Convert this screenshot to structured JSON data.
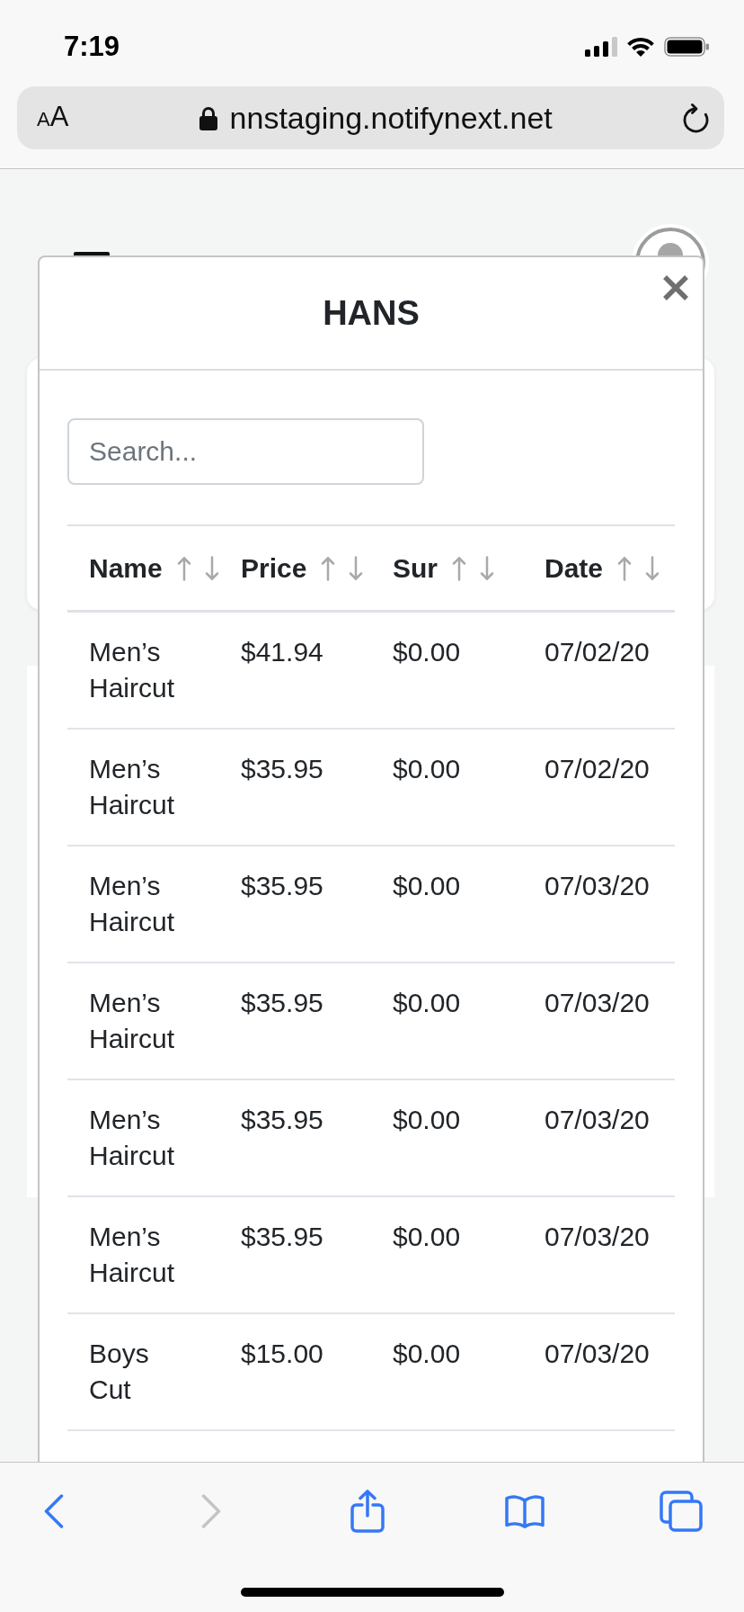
{
  "status_bar": {
    "time": "7:19"
  },
  "browser_bar": {
    "text_size_button": "AA",
    "url": "nnstaging.notifynext.net"
  },
  "modal": {
    "title": "HANS",
    "search": {
      "placeholder": "Search..."
    },
    "table": {
      "columns": [
        {
          "label": "Name"
        },
        {
          "label": "Price"
        },
        {
          "label": "Sur"
        },
        {
          "label": "Date"
        }
      ],
      "rows": [
        {
          "cells": [
            "Men’s Haircut",
            "$41.94",
            "$0.00",
            "07/02/20"
          ]
        },
        {
          "cells": [
            "Men’s Haircut",
            "$35.95",
            "$0.00",
            "07/02/20"
          ]
        },
        {
          "cells": [
            "Men’s Haircut",
            "$35.95",
            "$0.00",
            "07/03/20"
          ]
        },
        {
          "cells": [
            "Men’s Haircut",
            "$35.95",
            "$0.00",
            "07/03/20"
          ]
        },
        {
          "cells": [
            "Men’s Haircut",
            "$35.95",
            "$0.00",
            "07/03/20"
          ]
        },
        {
          "cells": [
            "Men’s Haircut",
            "$35.95",
            "$0.00",
            "07/03/20"
          ]
        },
        {
          "cells": [
            "Boys Cut",
            "$15.00",
            "$0.00",
            "07/03/20"
          ]
        }
      ]
    }
  },
  "toolbar": {
    "buttons": [
      {
        "kind": "back",
        "disabled": false
      },
      {
        "kind": "forward",
        "disabled": true
      },
      {
        "kind": "share",
        "disabled": false
      },
      {
        "kind": "bookmarks",
        "disabled": false
      },
      {
        "kind": "tabs",
        "disabled": false
      }
    ]
  }
}
